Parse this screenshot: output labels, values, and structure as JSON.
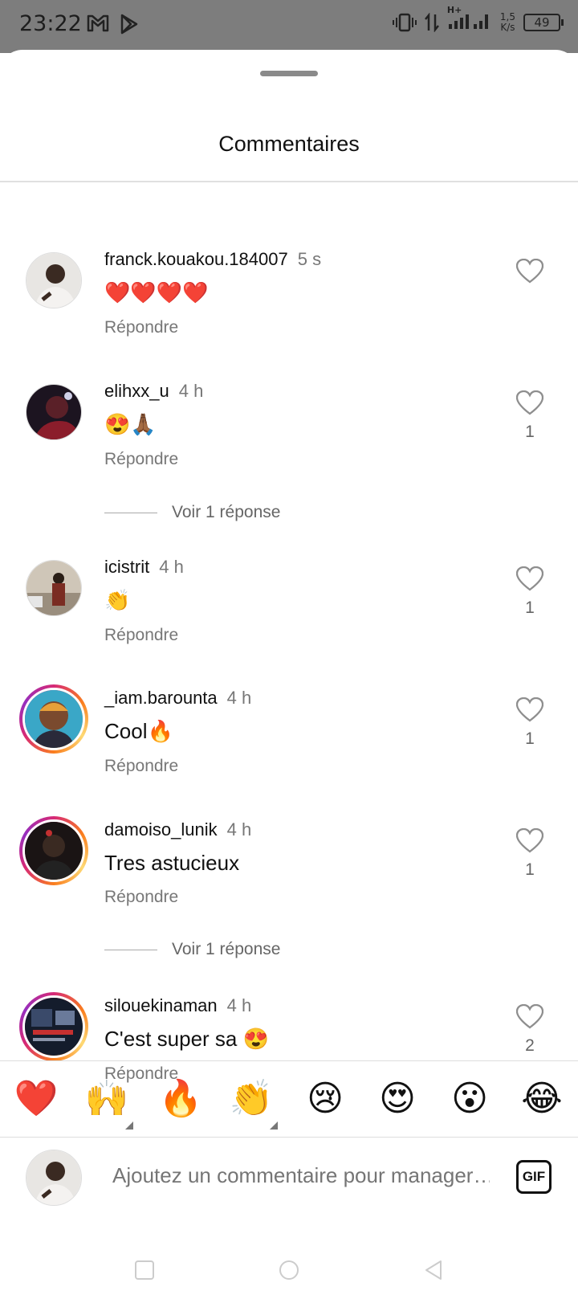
{
  "status_bar": {
    "time": "23:22",
    "net_speed_value": "1,5",
    "net_speed_unit": "K/s",
    "battery": "49",
    "network_type": "H+"
  },
  "sheet": {
    "title": "Commentaires"
  },
  "comments": [
    {
      "username": "franck.kouakou.184007",
      "time": "5 s",
      "text": "❤️❤️❤️❤️",
      "reply": "Répondre",
      "likes": ""
    },
    {
      "username": "elihxx_u",
      "time": "4 h",
      "text": "😍🙏🏾",
      "reply": "Répondre",
      "likes": "1",
      "view_replies": "Voir 1 réponse"
    },
    {
      "username": "icistrit",
      "time": "4 h",
      "text": "👏",
      "reply": "Répondre",
      "likes": "1"
    },
    {
      "username": "_iam.barounta",
      "time": "4 h",
      "text": "Cool🔥",
      "reply": "Répondre",
      "likes": "1"
    },
    {
      "username": "damoiso_lunik",
      "time": "4 h",
      "text": "Tres astucieux",
      "reply": "Répondre",
      "likes": "1",
      "view_replies": "Voir 1 réponse"
    },
    {
      "username": "silouekinaman",
      "time": "4 h",
      "text": "C'est super sa 😍",
      "reply": "Répondre",
      "likes": "2"
    }
  ],
  "emoji_bar": [
    "❤️",
    "🙌",
    "🔥",
    "👏",
    "😢",
    "😍",
    "😮",
    "😂"
  ],
  "input": {
    "placeholder": "Ajoutez un commentaire pour manager…",
    "gif_label": "GIF"
  }
}
